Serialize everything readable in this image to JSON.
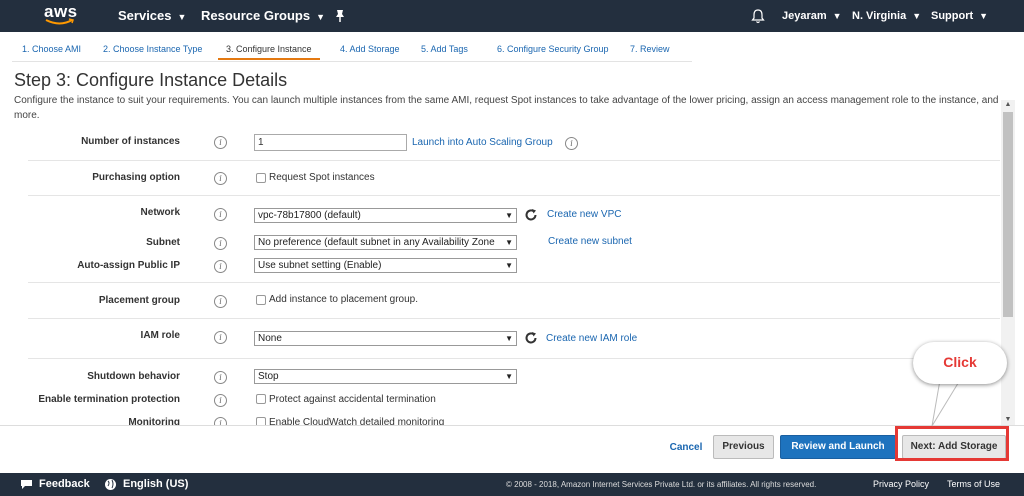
{
  "topnav": {
    "logo": "aws",
    "services": "Services",
    "resource_groups": "Resource Groups",
    "user": "Jeyaram",
    "region": "N. Virginia",
    "support": "Support"
  },
  "steps": [
    {
      "label": "1. Choose AMI",
      "active": false
    },
    {
      "label": "2. Choose Instance Type",
      "active": false
    },
    {
      "label": "3. Configure Instance",
      "active": true
    },
    {
      "label": "4. Add Storage",
      "active": false
    },
    {
      "label": "5. Add Tags",
      "active": false
    },
    {
      "label": "6. Configure Security Group",
      "active": false
    },
    {
      "label": "7. Review",
      "active": false
    }
  ],
  "page": {
    "title": "Step 3: Configure Instance Details",
    "description": "Configure the instance to suit your requirements. You can launch multiple instances from the same AMI, request Spot instances to take advantage of the lower pricing, assign an access management role to the instance, and more."
  },
  "form": {
    "number_of_instances": {
      "label": "Number of instances",
      "value": "1",
      "link": "Launch into Auto Scaling Group"
    },
    "purchasing_option": {
      "label": "Purchasing option",
      "checkbox": "Request Spot instances"
    },
    "network": {
      "label": "Network",
      "value": "vpc-78b17800 (default)",
      "link": "Create new VPC"
    },
    "subnet": {
      "label": "Subnet",
      "value": "No preference (default subnet in any Availability Zone",
      "link": "Create new subnet"
    },
    "auto_assign_ip": {
      "label": "Auto-assign Public IP",
      "value": "Use subnet setting (Enable)"
    },
    "placement_group": {
      "label": "Placement group",
      "checkbox": "Add instance to placement group."
    },
    "iam_role": {
      "label": "IAM role",
      "value": "None",
      "link": "Create new IAM role"
    },
    "shutdown_behavior": {
      "label": "Shutdown behavior",
      "value": "Stop"
    },
    "termination_protection": {
      "label": "Enable termination protection",
      "checkbox": "Protect against accidental termination"
    },
    "monitoring": {
      "label": "Monitoring",
      "checkbox": "Enable CloudWatch detailed monitoring"
    },
    "info_glyph": "i"
  },
  "actions": {
    "cancel": "Cancel",
    "previous": "Previous",
    "review_launch": "Review and Launch",
    "next": "Next: Add Storage"
  },
  "callout": {
    "text": "Click"
  },
  "footer": {
    "feedback": "Feedback",
    "language": "English (US)",
    "copyright": "© 2008 - 2018, Amazon Internet Services Private Ltd. or its affiliates. All rights reserved.",
    "privacy": "Privacy Policy",
    "terms": "Terms of Use"
  },
  "colors": {
    "nav_bg": "#232f3e",
    "link": "#1a66b0",
    "active_step_underline": "#e47911",
    "primary_button": "#1e73be",
    "highlight": "#e53935"
  },
  "icons": {
    "bell": "bell-icon",
    "pin": "pin-icon",
    "refresh": "refresh-icon",
    "feedback": "chat-bubble-icon",
    "language": "globe-icon"
  }
}
